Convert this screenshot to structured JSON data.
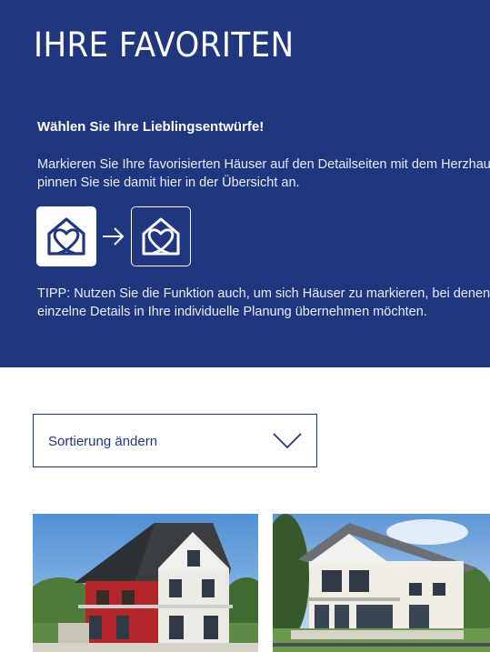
{
  "hero": {
    "title": "IHRE FAVORITEN",
    "subtitle": "Wählen Sie Ihre Lieblingsentwürfe!",
    "description_line1": "Markieren Sie Ihre favorisierten Häuser auf den Detailseiten mit dem Herzhaus und",
    "description_line2": "pinnen Sie sie damit hier in der Übersicht an.",
    "tip_line1": "TIPP: Nutzen Sie die Funktion auch, um sich Häuser zu markieren, bei denen Sie",
    "tip_line2": "einzelne Details in Ihre individuelle Planung übernehmen möchten.",
    "icons": [
      "heart-house-filled-icon",
      "arrow-right-icon",
      "heart-house-outline-icon"
    ]
  },
  "sort": {
    "label": "Sortierung ändern",
    "icon": "chevron-down-icon"
  },
  "houses": [
    {
      "name": "house-card-1"
    },
    {
      "name": "house-card-2"
    }
  ],
  "colors": {
    "brand_blue": "#20377f",
    "white": "#ffffff"
  }
}
